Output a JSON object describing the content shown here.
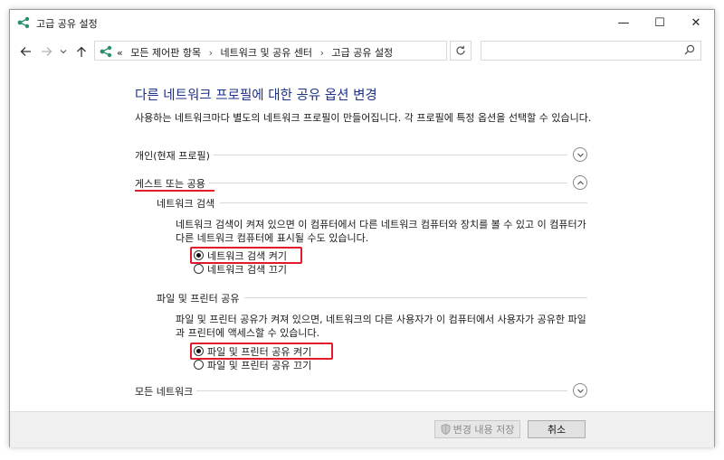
{
  "window": {
    "title": "고급 공유 설정",
    "controls": {
      "minimize": "—",
      "maximize": "☐",
      "close": "✕"
    }
  },
  "address_bar": {
    "overflow": "«",
    "crumbs": [
      "모든 제어판 항목",
      "네트워크 및 공유 센터",
      "고급 공유 설정"
    ],
    "separator": "›",
    "dropdown_icon": "chevron-down-icon",
    "refresh_icon": "refresh-icon",
    "search_placeholder": ""
  },
  "main": {
    "title": "다른 네트워크 프로필에 대한 공유 옵션 변경",
    "description": "사용하는 네트워크마다 별도의 네트워크 프로필이 만들어집니다. 각 프로필에 특정 옵션을 선택할 수 있습니다.",
    "profiles": {
      "private": {
        "label": "개인(현재 프로필)",
        "expanded": false
      },
      "guest": {
        "label": "게스트 또는 공용",
        "expanded": true,
        "network_discovery": {
          "heading": "네트워크 검색",
          "description": "네트워크 검색이 켜져 있으면 이 컴퓨터에서 다른 네트워크 컴퓨터와 장치를 볼 수 있고 이 컴퓨터가 다른 네트워크 컴퓨터에 표시될 수도 있습니다.",
          "options": [
            {
              "label": "네트워크 검색 켜기",
              "selected": true
            },
            {
              "label": "네트워크 검색 끄기",
              "selected": false
            }
          ]
        },
        "file_printer_sharing": {
          "heading": "파일 및 프린터 공유",
          "description": "파일 및 프린터 공유가 켜져 있으면, 네트워크의 다른 사용자가 이 컴퓨터에서 사용자가 공유한 파일과 프린터에 액세스할 수 있습니다.",
          "options": [
            {
              "label": "파일 및 프린터 공유 켜기",
              "selected": true
            },
            {
              "label": "파일 및 프린터 공유 끄기",
              "selected": false
            }
          ]
        }
      },
      "all": {
        "label": "모든 네트워크",
        "expanded": false
      }
    }
  },
  "footer": {
    "save_label": "변경 내용 저장",
    "cancel_label": "취소"
  },
  "colors": {
    "title_blue": "#1e3287",
    "highlight_red": "#e3192c",
    "footer_bg": "#f0f0f0"
  }
}
